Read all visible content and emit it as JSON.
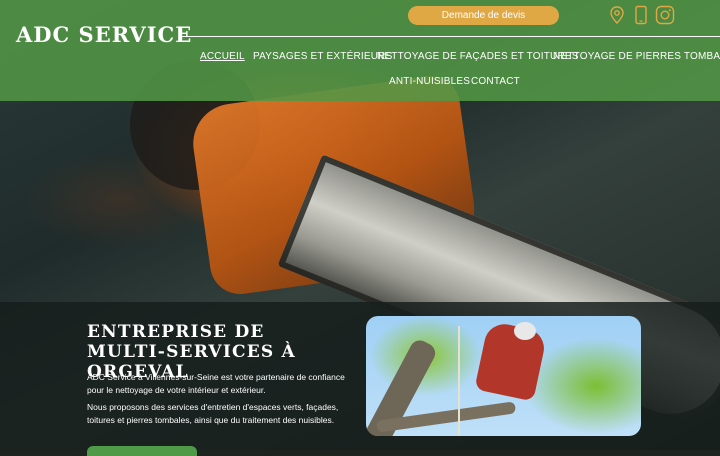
{
  "brand": {
    "name": "ADC SERVICE"
  },
  "header": {
    "quote_button": "Demande de devis"
  },
  "icons": [
    "location-pin-icon",
    "phone-icon",
    "instagram-icon"
  ],
  "nav": {
    "items": [
      "ACCUEIL",
      "PAYSAGES ET EXTÉRIEURS",
      "NETTOYAGE DE FAÇADES ET TOITURES",
      "NETTOYAGE DE PIERRES TOMBALES",
      "ANTI-NUISIBLES",
      "CONTACT"
    ],
    "active": "ACCUEIL"
  },
  "hero": {
    "title": "ENTREPRISE DE MULTI-SERVICES À ORGEVAL",
    "paragraph1": "ADC Service à Villennes-sur-Seine est votre partenaire de confiance pour le nettoyage de votre intérieur et extérieur.",
    "paragraph2": "Nous proposons des services d'entretien d'espaces verts, façades, toitures et pierres tombales, ainsi que du traitement des nuisibles."
  },
  "colors": {
    "header_green": "#529646",
    "quote_button": "#e0a845",
    "panel_dark": "#161e1b",
    "cta_green": "#4e9a47"
  }
}
